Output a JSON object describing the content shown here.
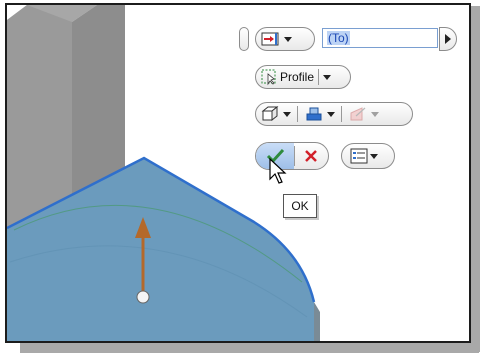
{
  "toolbar": {
    "extents_value": "(To)",
    "profile_label": "Profile",
    "tooltip_ok": "OK"
  },
  "icons": {
    "extents": "extents-to-icon",
    "profile": "profile-select-icon",
    "solid": "solid-body-icon",
    "direction": "direction-icon",
    "match_shape": "match-shape-icon",
    "ok": "checkmark-icon",
    "cancel": "cancel-x-icon",
    "options": "options-list-icon",
    "next": "play-arrow-icon"
  },
  "colors": {
    "surface": "#6b9bbd",
    "edge": "#2f6fcc",
    "arrow": "#b4692a",
    "ok_green": "#2e8b3d",
    "cancel_red": "#d2202a"
  }
}
